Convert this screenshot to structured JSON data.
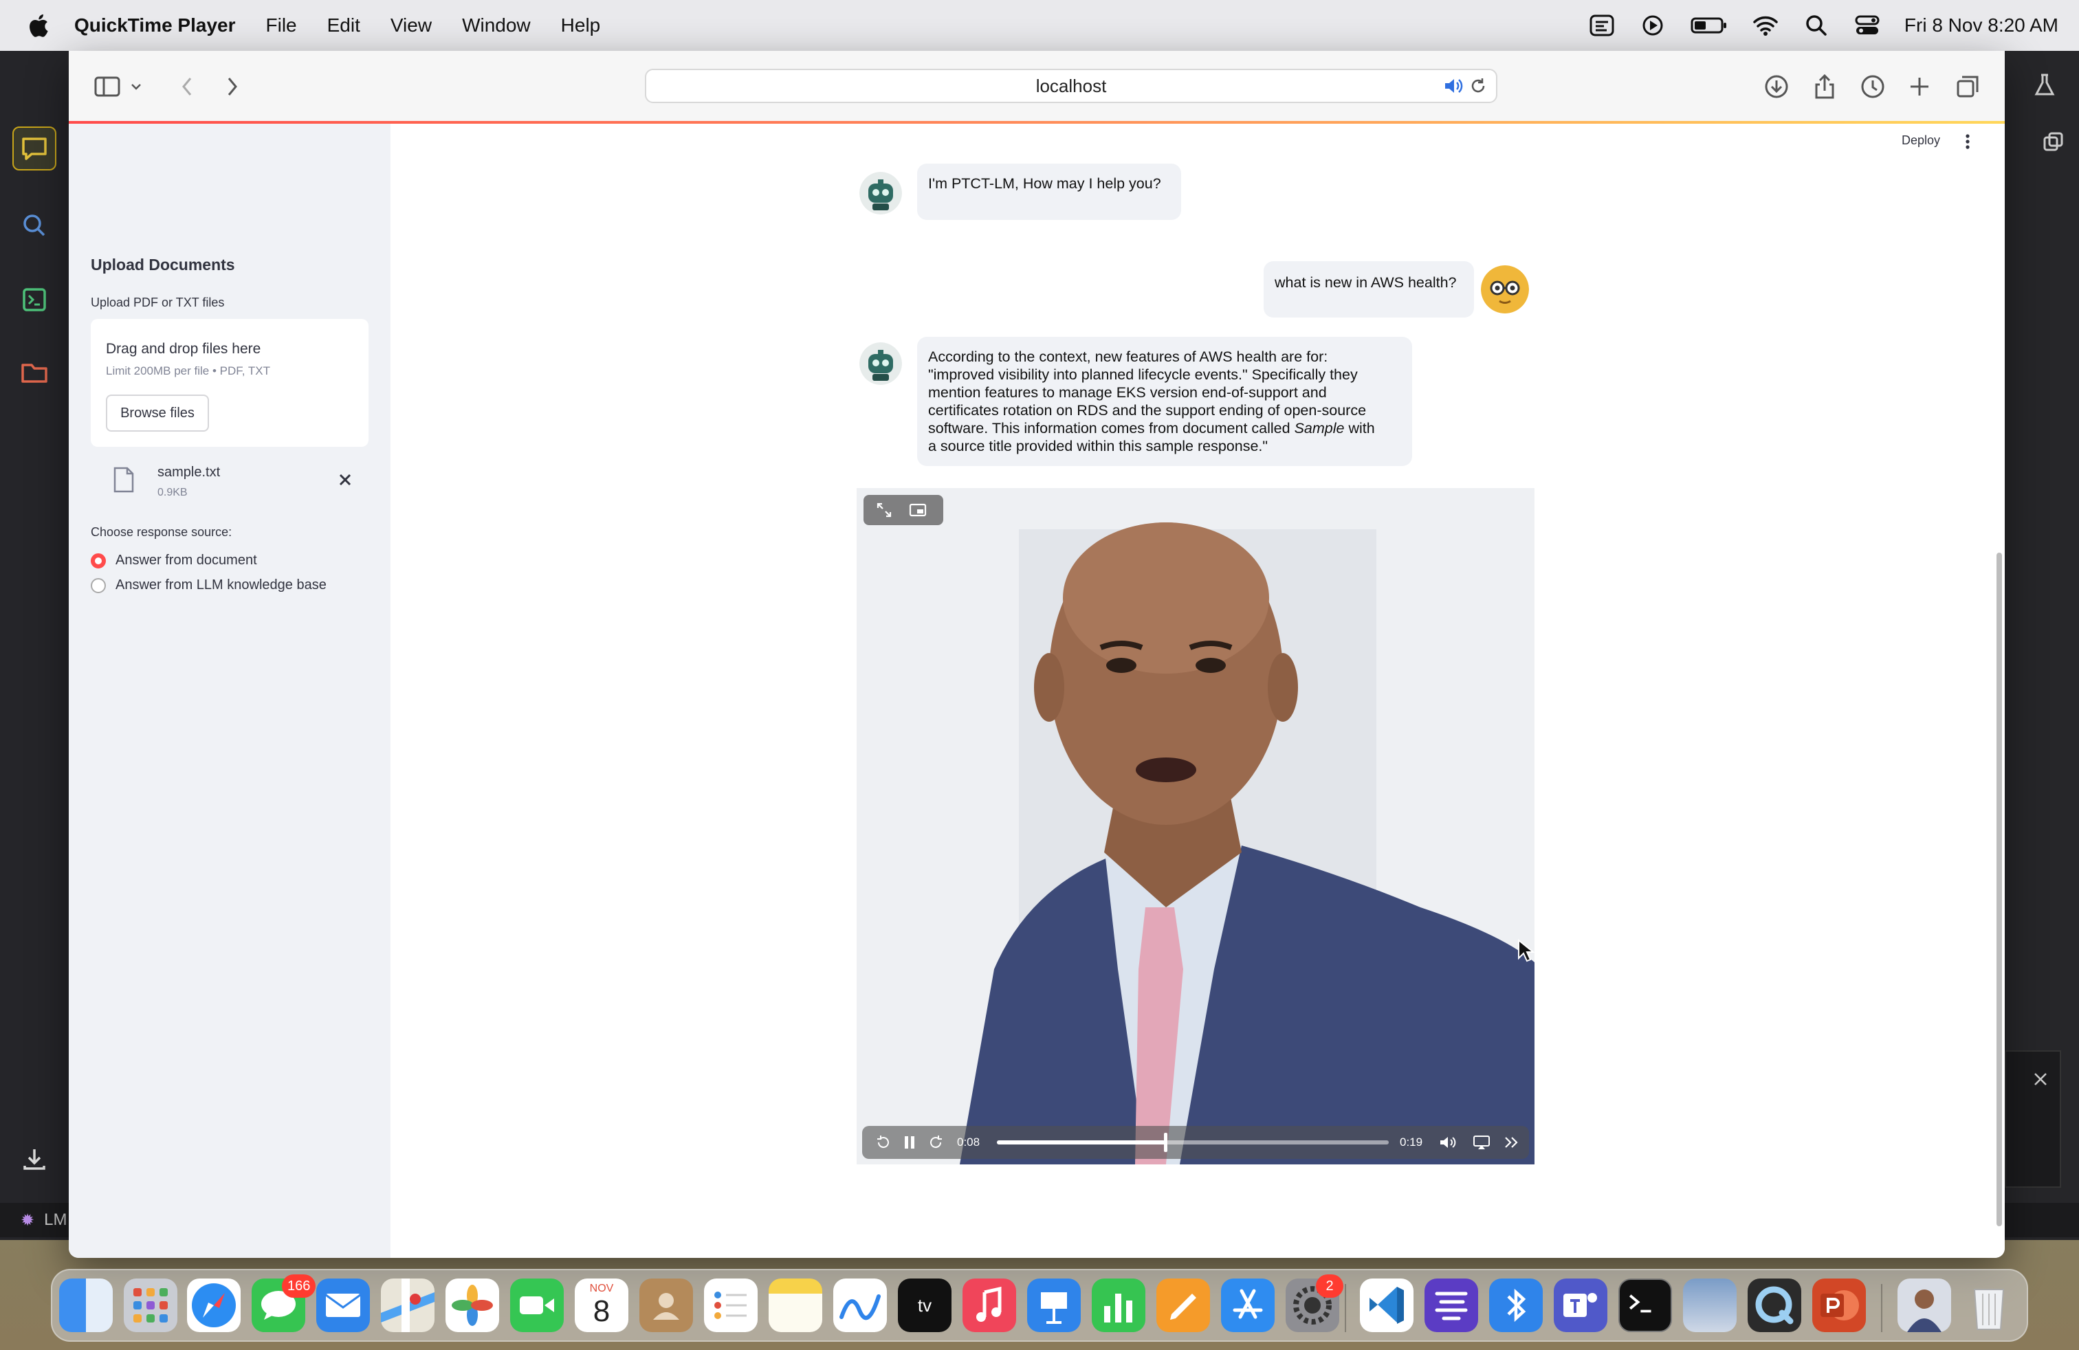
{
  "menubar": {
    "app_name": "QuickTime Player",
    "menus": [
      "File",
      "Edit",
      "View",
      "Window",
      "Help"
    ],
    "clock": "Fri 8 Nov  8:20 AM"
  },
  "browser": {
    "address": "localhost"
  },
  "sidebar": {
    "title": "Upload Documents",
    "upload_label": "Upload PDF or TXT files",
    "dropzone_title": "Drag and drop files here",
    "dropzone_limit": "Limit 200MB per file • PDF, TXT",
    "browse_label": "Browse files",
    "file": {
      "name": "sample.txt",
      "size": "0.9KB"
    },
    "radio_label": "Choose response source:",
    "options": [
      "Answer from document",
      "Answer from LLM knowledge base"
    ],
    "selected_option": "Answer from document"
  },
  "header": {
    "deploy_label": "Deploy"
  },
  "chat": {
    "messages": [
      {
        "role": "assistant",
        "text": "I'm PTCT-LM, How may I help you?"
      },
      {
        "role": "user",
        "text": "what is new in AWS health?"
      },
      {
        "role": "assistant",
        "lines": [
          "According to the context, new features of AWS health are for:",
          "\"improved visibility into planned lifecycle events.\" Specifically they",
          "mention features to manage EKS version end-of-support and",
          "certificates rotation on RDS and the support ending of open-source",
          "software. This information comes from document called",
          "Sample",
          " with",
          "a source title provided within this sample response.\""
        ]
      }
    ]
  },
  "video": {
    "current_time": "0:08",
    "duration": "0:19",
    "progress": 0.43
  },
  "background_app": {
    "status_text": "LM"
  },
  "dock": {
    "messages_badge": "166",
    "settings_badge": "2",
    "calendar_month": "NOV",
    "calendar_day": "8"
  },
  "colors": {
    "accent": "#ff4b4b",
    "sidebar_bg": "#f0f2f6"
  }
}
